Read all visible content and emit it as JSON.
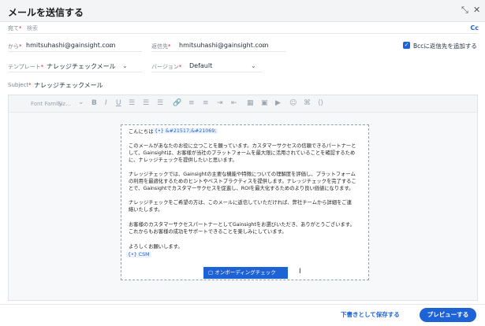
{
  "header": {
    "title": "メールを送信する",
    "minimize_glyph": "⤡",
    "close_glyph": "✕"
  },
  "fields": {
    "to_label": "宛て",
    "search_placeholder": "検索",
    "cc_label": "Cc",
    "from_label": "から",
    "from_value": "hmitsuhashi@gainsight.com",
    "reply_to_label": "返信先",
    "reply_to_value": "hmitsuhashi@gainsight.com",
    "bcc_label": "Bccに返信先を追加する",
    "bcc_checked": true,
    "template_label": "テンプレート",
    "template_value": "ナレッジチェックメール",
    "version_label": "バージョン",
    "version_value": "Default",
    "subject_label": "Subject",
    "subject_value": "ナレッジチェックメール",
    "required_mark": "*"
  },
  "toolbar": {
    "font_family": "Font Family",
    "font_size": "Siz...",
    "buttons": [
      "bold-icon",
      "italic-icon",
      "underline-icon",
      "align-left-icon",
      "align-center-icon",
      "align-right-icon",
      "link-icon",
      "bulleted-list-icon",
      "numbered-list-icon",
      "indent-icon",
      "outdent-icon",
      "table-icon",
      "image-icon",
      "video-icon",
      "emoji-icon",
      "html-icon",
      "code-icon"
    ]
  },
  "email_body": {
    "greeting": "こんにちは",
    "greeting_token": "{•} &#21517;&#21069;",
    "p1": [
      "このメールがあなたのお役に立つことを願っています。カスタマーサクセスの信頼できるパートナーと",
      "して、Gainsightは、お客様が当社のプラットフォームを最大限に活用されていることを確認するため",
      "に、ナレッジチェックを提供したいと思います。"
    ],
    "p2": [
      "ナレッジチェックでは、Gainsightの主要な機能や特徴についての理解度を評価し、プラットフォーム",
      "の利用を最適化するためのヒントやベストプラクティスを提供します。ナレッジチェックを完了するこ",
      "とで、Gainsightでカスタマーサクセスを促進し、ROIを最大化するためのより良い価値になります。"
    ],
    "p3": [
      "ナレッジチェックをご希望の方は、このメールに返信していただければ、弊社チームから詳細をご連",
      "絡いたします。"
    ],
    "p4": [
      "お客様のカスタマーサクセスパートナーとしてGainsightをお選びいただき、ありがとうございます。",
      "これからもお客様の成功をサポートできることを楽しみにしています。"
    ],
    "closing": "よろしくお願いします。",
    "signature_token": "{•} CSM",
    "block_button": "オンボーディングチェック"
  },
  "footer": {
    "save_draft": "下書きとして保存する",
    "preview": "プレビューする"
  },
  "colors": {
    "accent": "#1e63d6",
    "required": "#e02020"
  }
}
